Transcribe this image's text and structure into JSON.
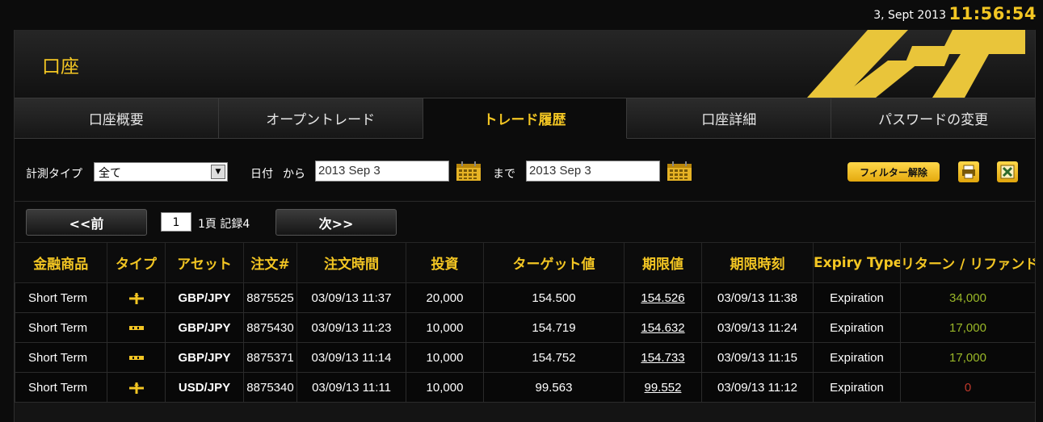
{
  "topbar": {
    "date": "3, Sept 2013",
    "time": "11:56:54"
  },
  "header": {
    "title": "口座"
  },
  "colors": {
    "accent": "#f3c623",
    "positive": "#9ab728",
    "negative": "#c0392b"
  },
  "tabs": [
    {
      "label": "口座概要",
      "active": false
    },
    {
      "label": "オープントレード",
      "active": false
    },
    {
      "label": "トレード履歴",
      "active": true
    },
    {
      "label": "口座詳細",
      "active": false
    },
    {
      "label": "パスワードの変更",
      "active": false
    }
  ],
  "filter": {
    "type_label": "計測タイプ",
    "type_value": "全て",
    "date_label": "日付",
    "from_label": "から",
    "from_value": "2013 Sep 3",
    "to_label": "まで",
    "to_value": "2013 Sep 3",
    "clear_button": "フィルター解除",
    "icons": [
      "print-icon",
      "excel-export-icon",
      "calendar-icon"
    ]
  },
  "pager": {
    "prev_label": "<<前",
    "page": "1",
    "info": "1頁 記録4",
    "next_label": "次>>"
  },
  "table": {
    "columns": [
      "金融商品",
      "タイプ",
      "アセット",
      "注文#",
      "注文時間",
      "投資",
      "ターゲット値",
      "期限値",
      "期限時刻",
      "Expiry Type",
      "リターン / リファンド"
    ],
    "rows": [
      {
        "instrument": "Short Term",
        "type_icon": "call-put-icon",
        "asset": "GBP/JPY",
        "order": "8875525",
        "order_time": "03/09/13 11:37",
        "investment": "20,000",
        "target": "154.500",
        "expiry_value": "154.526",
        "expiry_time": "03/09/13 11:38",
        "expiry_type": "Expiration",
        "return": "34,000",
        "result": "win"
      },
      {
        "instrument": "Short Term",
        "type_icon": "range-icon",
        "asset": "GBP/JPY",
        "order": "8875430",
        "order_time": "03/09/13 11:23",
        "investment": "10,000",
        "target": "154.719",
        "expiry_value": "154.632",
        "expiry_time": "03/09/13 11:24",
        "expiry_type": "Expiration",
        "return": "17,000",
        "result": "win"
      },
      {
        "instrument": "Short Term",
        "type_icon": "range-icon",
        "asset": "GBP/JPY",
        "order": "8875371",
        "order_time": "03/09/13 11:14",
        "investment": "10,000",
        "target": "154.752",
        "expiry_value": "154.733",
        "expiry_time": "03/09/13 11:15",
        "expiry_type": "Expiration",
        "return": "17,000",
        "result": "win"
      },
      {
        "instrument": "Short Term",
        "type_icon": "call-put-icon",
        "asset": "USD/JPY",
        "order": "8875340",
        "order_time": "03/09/13 11:11",
        "investment": "10,000",
        "target": "99.563",
        "expiry_value": "99.552",
        "expiry_time": "03/09/13 11:12",
        "expiry_type": "Expiration",
        "return": "0",
        "result": "loss"
      }
    ]
  }
}
